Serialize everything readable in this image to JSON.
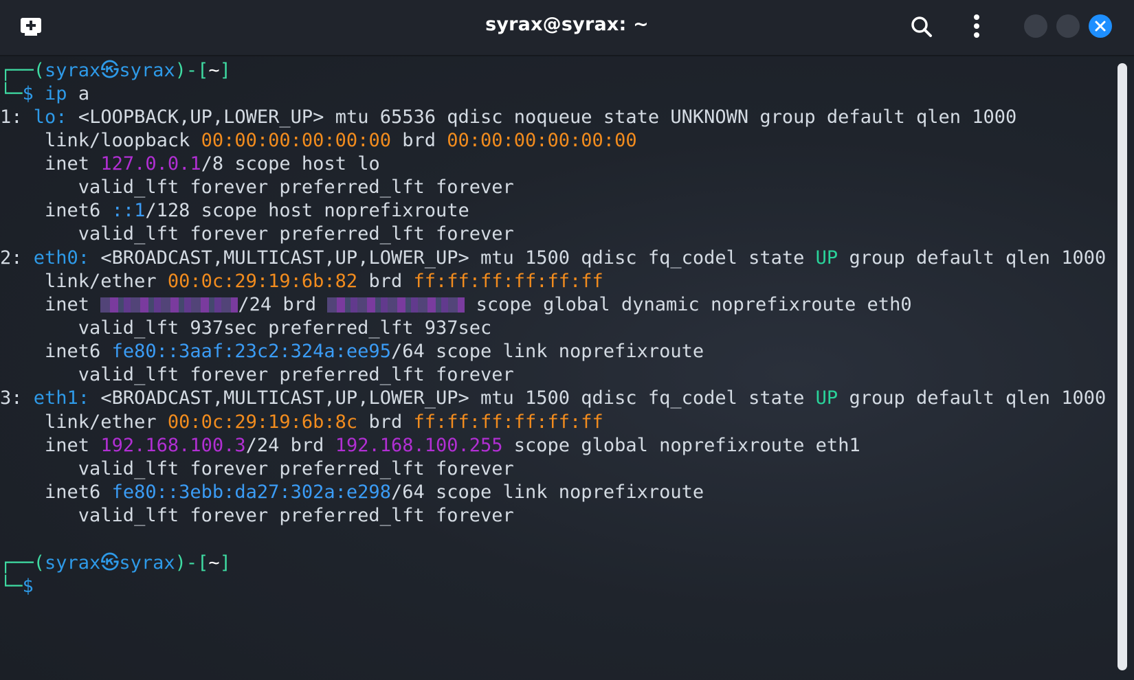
{
  "window": {
    "title": "syrax@syrax: ~",
    "accent": "#1e8fff",
    "icons": [
      "new-tab-icon",
      "search-icon",
      "kebab-menu-icon",
      "minimize",
      "maximize",
      "close-icon"
    ]
  },
  "prompt1": {
    "open": "┌──(",
    "user": "syrax",
    "at": "㉿",
    "host": "syrax",
    "close": ")-[",
    "dir": "~",
    "end": "]",
    "corner": "└─",
    "dollar": "$",
    "cmd": "ip",
    "arg": " a"
  },
  "output": {
    "l1": {
      "num": "1: ",
      "iface": "lo:",
      "rest": " <LOOPBACK,UP,LOWER_UP> mtu 65536 qdisc noqueue state UNKNOWN group default qlen 1000"
    },
    "l2": {
      "a": "    link/loopback ",
      "mac": "00:00:00:00:00:00",
      "b": " brd ",
      "brd": "00:00:00:00:00:00"
    },
    "l3": {
      "a": "    inet ",
      "ip": "127.0.0.1",
      "b": "/8 scope host lo"
    },
    "l4": "       valid_lft forever preferred_lft forever",
    "l5": {
      "a": "    inet6 ",
      "ip": "::1",
      "b": "/128 scope host noprefixroute"
    },
    "l6": "       valid_lft forever preferred_lft forever",
    "l7": {
      "num": "2: ",
      "iface": "eth0:",
      "a": " <BROADCAST,MULTICAST,UP,LOWER_UP> mtu 1500 qdisc fq_codel state ",
      "state": "UP",
      "b": " group default qlen 1000"
    },
    "l8": {
      "a": "    link/ether ",
      "mac": "00:0c:29:19:6b:82",
      "b": " brd ",
      "brd": "ff:ff:ff:ff:ff:ff"
    },
    "l9": {
      "a": "    inet ",
      "b": "/24 brd ",
      "c": " scope global dynamic noprefixroute eth0"
    },
    "l10": "       valid_lft 937sec preferred_lft 937sec",
    "l11": {
      "a": "    inet6 ",
      "ip": "fe80::3aaf:23c2:324a:ee95",
      "b": "/64 scope link noprefixroute"
    },
    "l12": "       valid_lft forever preferred_lft forever",
    "l13": {
      "num": "3: ",
      "iface": "eth1:",
      "a": " <BROADCAST,MULTICAST,UP,LOWER_UP> mtu 1500 qdisc fq_codel state ",
      "state": "UP",
      "b": " group default qlen 1000"
    },
    "l14": {
      "a": "    link/ether ",
      "mac": "00:0c:29:19:6b:8c",
      "b": " brd ",
      "brd": "ff:ff:ff:ff:ff:ff"
    },
    "l15": {
      "a": "    inet ",
      "ip": "192.168.100.3",
      "b": "/24 brd ",
      "brd": "192.168.100.255",
      "c": " scope global noprefixroute eth1"
    },
    "l16": "       valid_lft forever preferred_lft forever",
    "l17": {
      "a": "    inet6 ",
      "ip": "fe80::3ebb:da27:302a:e298",
      "b": "/64 scope link noprefixroute"
    },
    "l18": "       valid_lft forever preferred_lft forever"
  },
  "prompt2": {
    "open": "┌──(",
    "user": "syrax",
    "at": "㉿",
    "host": "syrax",
    "close": ")-[",
    "dir": "~",
    "end": "]",
    "corner": "└─",
    "dollar": "$"
  }
}
